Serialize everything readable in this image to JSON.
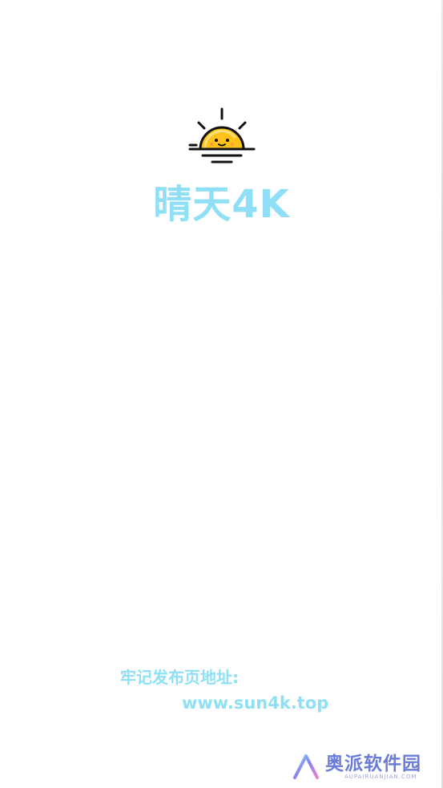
{
  "splash": {
    "logo_icon": "sun-face-icon",
    "title": "晴天4K",
    "accent_color": "#8fe0f6"
  },
  "notice": {
    "label": "牢记发布页地址:",
    "url": "www.sun4k.top"
  },
  "watermark": {
    "icon": "aupai-logo-icon",
    "text": "奥派软件园",
    "subtext": "AUPAIRUANJIAN.COM"
  }
}
